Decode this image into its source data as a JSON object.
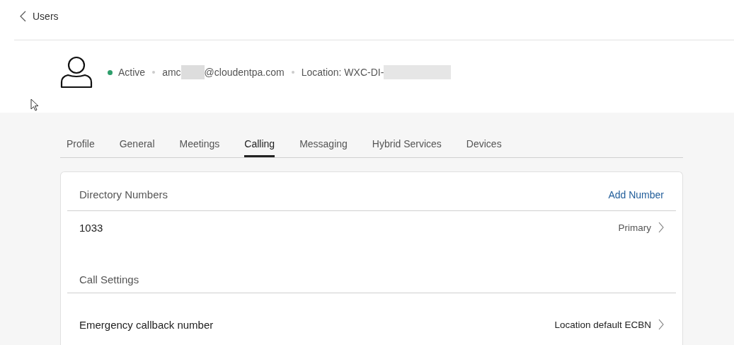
{
  "back_link": {
    "label": "Users"
  },
  "user": {
    "status": {
      "label": "Active",
      "color": "#2e9e6b"
    },
    "email_start": "amc",
    "email_end": "@cloudentpa.com",
    "location": "Location: WXC-DI-"
  },
  "tabs": [
    {
      "label": "Profile",
      "selected": false
    },
    {
      "label": "General",
      "selected": false
    },
    {
      "label": "Meetings",
      "selected": false
    },
    {
      "label": "Calling",
      "selected": true
    },
    {
      "label": "Messaging",
      "selected": false
    },
    {
      "label": "Hybrid Services",
      "selected": false
    },
    {
      "label": "Devices",
      "selected": false
    }
  ],
  "directory_numbers": {
    "title": "Directory Numbers",
    "action": "Add Number",
    "rows": [
      {
        "number": "1033",
        "value": "Primary"
      }
    ]
  },
  "call_settings": {
    "title": "Call Settings",
    "rows": [
      {
        "label": "Emergency callback number",
        "value": "Location default ECBN"
      }
    ]
  }
}
